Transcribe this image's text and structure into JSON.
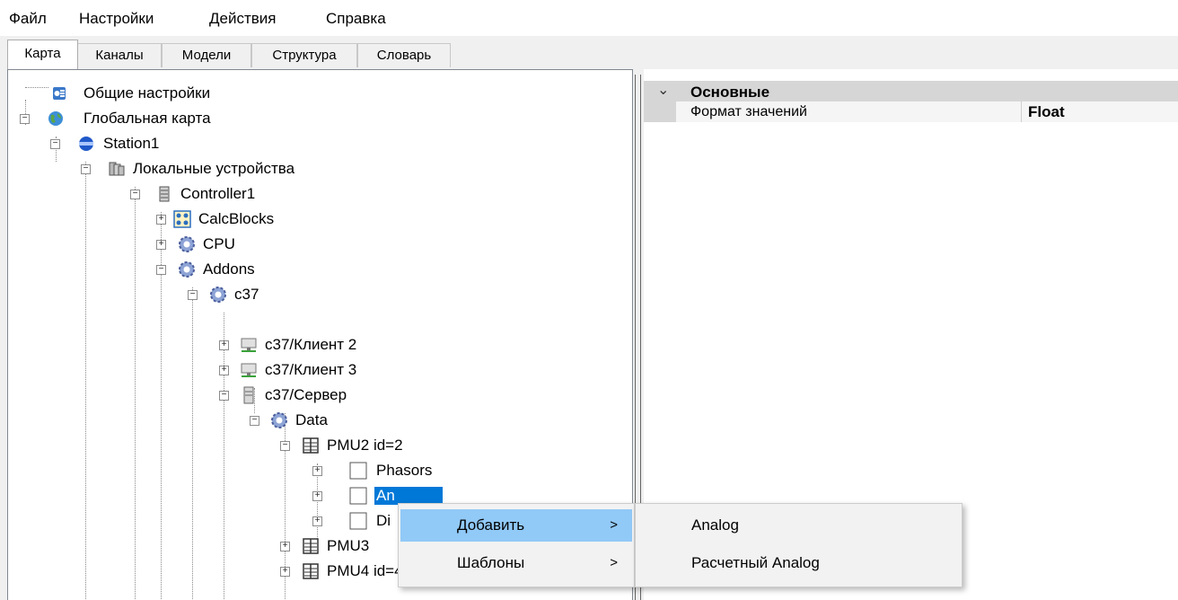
{
  "menubar": [
    "Файл",
    "Настройки",
    "Действия",
    "Справка"
  ],
  "tabs": [
    "Карта",
    "Каналы",
    "Модели",
    "Структура",
    "Словарь"
  ],
  "active_tab": "Карта",
  "tree": [
    {
      "label": "Общие настройки",
      "icon": "settings-doc-icon"
    },
    {
      "label": "Глобальная карта",
      "icon": "globe-icon"
    },
    {
      "label": "Station1",
      "icon": "station-icon"
    },
    {
      "label": "Локальные устройства",
      "icon": "devices-icon"
    },
    {
      "label": "Controller1",
      "icon": "controller-icon"
    },
    {
      "label": "CalcBlocks",
      "icon": "calcblocks-icon"
    },
    {
      "label": "CPU",
      "icon": "gear-icon"
    },
    {
      "label": "Addons",
      "icon": "gear-icon"
    },
    {
      "label": "c37",
      "icon": "gear-icon"
    },
    {
      "label": "c37/Клиент 2",
      "icon": "network-client-icon"
    },
    {
      "label": "c37/Клиент 3",
      "icon": "network-client-icon"
    },
    {
      "label": "c37/Сервер",
      "icon": "server-icon"
    },
    {
      "label": "Data",
      "icon": "gear-icon"
    },
    {
      "label": "PMU2 id=2",
      "icon": "pmu-icon"
    },
    {
      "label": "Phasors",
      "icon": "folder-box-icon"
    },
    {
      "label": "An",
      "icon": "folder-box-icon"
    },
    {
      "label": "Di",
      "icon": "folder-box-icon"
    },
    {
      "label": "PMU3",
      "icon": "pmu-icon"
    },
    {
      "label": "PMU4 id=4",
      "icon": "pmu-icon"
    }
  ],
  "properties": {
    "category": "Основные",
    "rows": [
      {
        "name": "Формат значений",
        "value": "Float"
      }
    ]
  },
  "context_menu": {
    "items": [
      {
        "label": "Добавить",
        "submenu": true,
        "arrow": ">"
      },
      {
        "label": "Шаблоны",
        "submenu": true,
        "arrow": ">"
      }
    ]
  },
  "submenu": {
    "items": [
      {
        "label": "Analog"
      },
      {
        "label": "Расчетный Analog"
      }
    ]
  },
  "colors": {
    "selection": "#0078d7",
    "menu_highlight": "#91c9f7"
  }
}
